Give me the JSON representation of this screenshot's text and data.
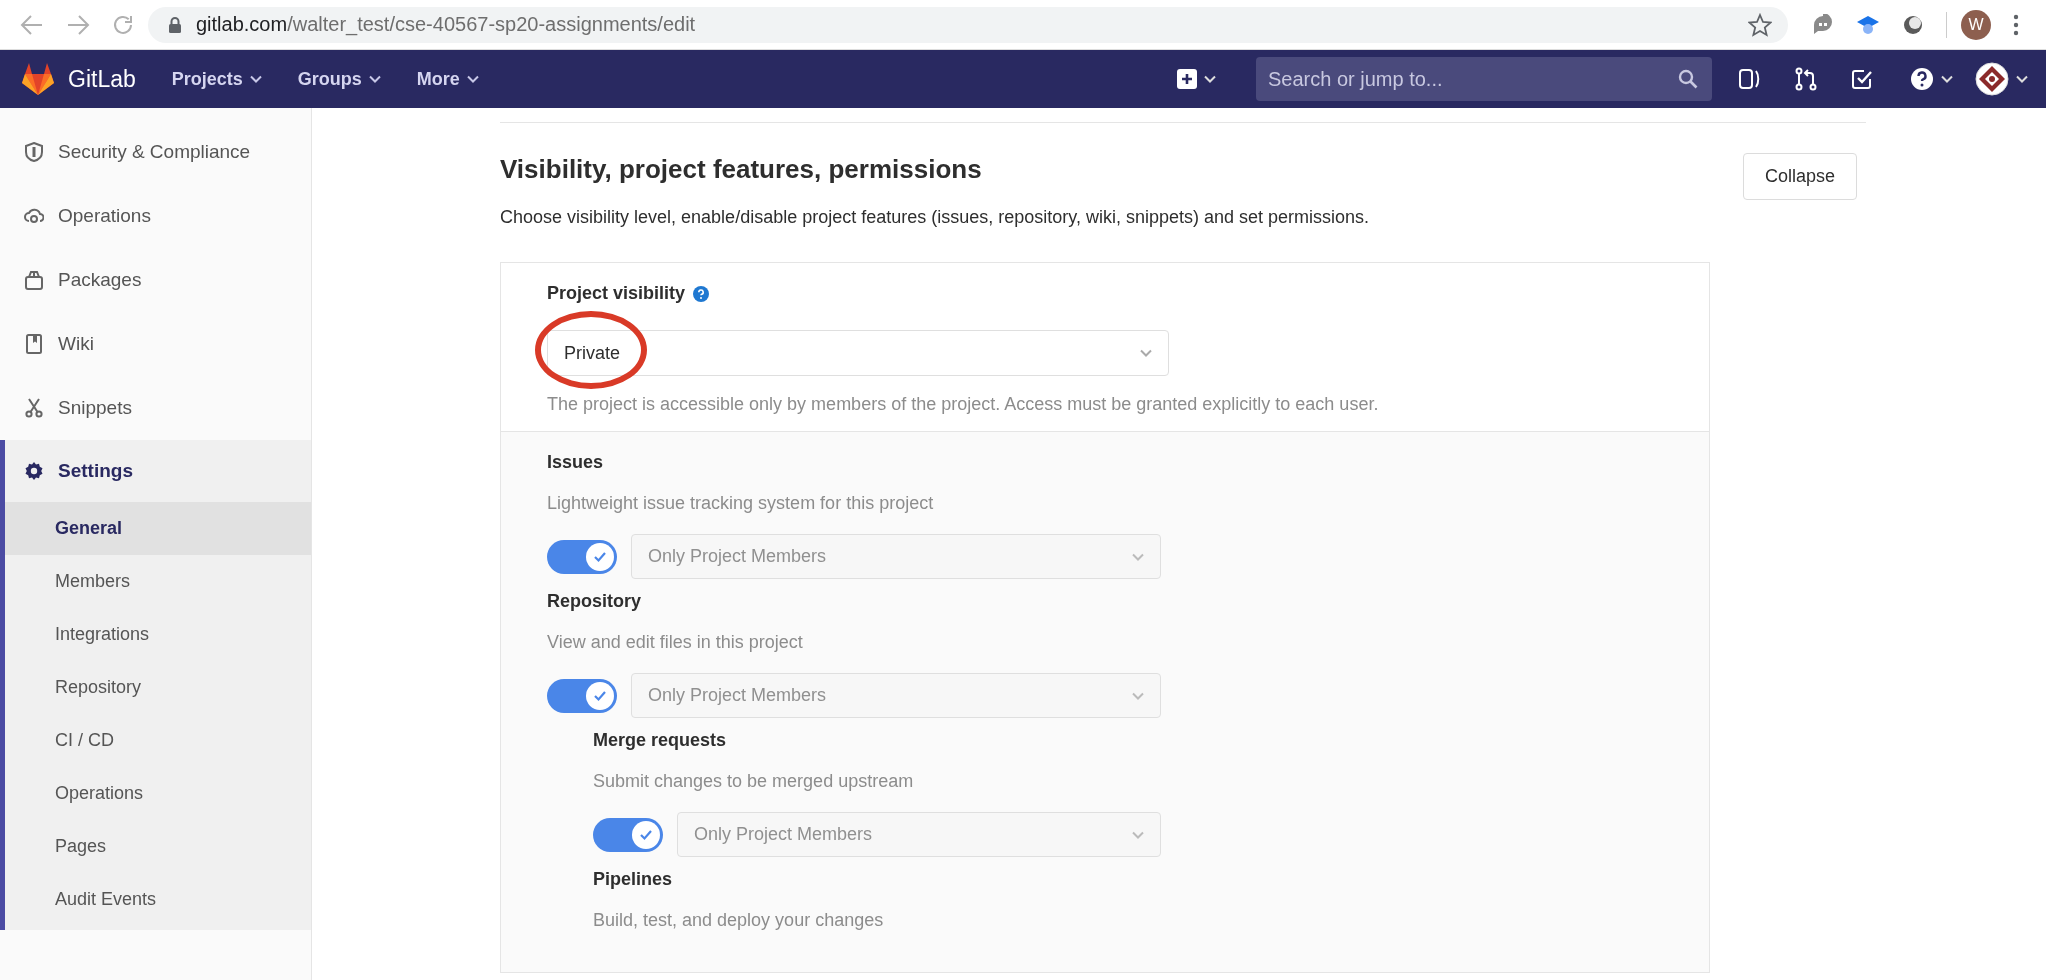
{
  "browser": {
    "url_host": "gitlab.com",
    "url_path": "/walter_test/cse-40567-sp20-assignments/edit",
    "profile_initial": "W"
  },
  "navbar": {
    "brand": "GitLab",
    "menus": [
      "Projects",
      "Groups",
      "More"
    ],
    "search_placeholder": "Search or jump to..."
  },
  "sidebar": {
    "items": [
      {
        "label": "Security & Compliance",
        "kind": "shield",
        "selected": false
      },
      {
        "label": "Operations",
        "kind": "cloud",
        "selected": false
      },
      {
        "label": "Packages",
        "kind": "package",
        "selected": false
      },
      {
        "label": "Wiki",
        "kind": "book",
        "selected": false
      },
      {
        "label": "Snippets",
        "kind": "scissors",
        "selected": false
      },
      {
        "label": "Settings",
        "kind": "gear",
        "selected": true,
        "expanded": true,
        "children": [
          {
            "label": "General",
            "selected": true
          },
          {
            "label": "Members",
            "selected": false
          },
          {
            "label": "Integrations",
            "selected": false
          },
          {
            "label": "Repository",
            "selected": false
          },
          {
            "label": "CI / CD",
            "selected": false
          },
          {
            "label": "Operations",
            "selected": false
          },
          {
            "label": "Pages",
            "selected": false
          },
          {
            "label": "Audit Events",
            "selected": false
          }
        ]
      }
    ]
  },
  "section": {
    "title": "Visibility, project features, permissions",
    "description": "Choose visibility level, enable/disable project features (issues, repository, wiki, snippets) and set permissions.",
    "collapse_button": "Collapse",
    "visibility": {
      "label": "Project visibility",
      "value": "Private",
      "hint": "The project is accessible only by members of the project. Access must be granted explicitly to each user.",
      "highlighted": true
    },
    "features": [
      {
        "title": "Issues",
        "description": "Lightweight issue tracking system for this project",
        "enabled": true,
        "access": "Only Project Members"
      },
      {
        "title": "Repository",
        "description": "View and edit files in this project",
        "enabled": true,
        "access": "Only Project Members",
        "children": [
          {
            "title": "Merge requests",
            "description": "Submit changes to be merged upstream",
            "enabled": true,
            "access": "Only Project Members"
          },
          {
            "title": "Pipelines",
            "description": "Build, test, and deploy your changes"
          }
        ]
      }
    ]
  }
}
